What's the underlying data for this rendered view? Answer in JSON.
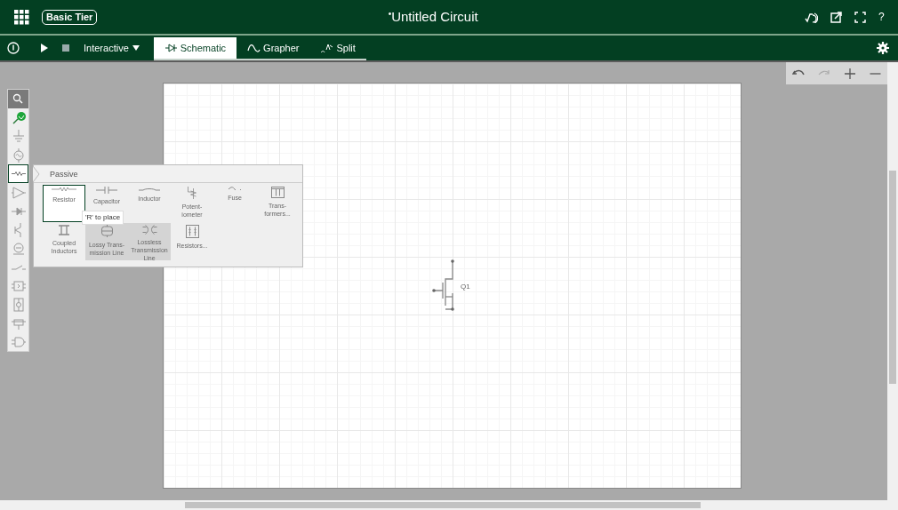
{
  "header": {
    "tier_badge": "Basic Tier",
    "modified_mark": "•",
    "title": "Untitled Circuit",
    "help": "?"
  },
  "toolbar": {
    "mode": "Interactive",
    "views": [
      {
        "label": "Schematic",
        "selected": true
      },
      {
        "label": "Grapher",
        "selected": false
      },
      {
        "label": "Split",
        "selected": false
      }
    ]
  },
  "palette": {
    "items": [
      {
        "selected": false
      },
      {
        "selected": false
      },
      {
        "selected": false
      },
      {
        "selected": false
      },
      {
        "selected": true
      },
      {
        "selected": false
      },
      {
        "selected": false
      },
      {
        "selected": false
      },
      {
        "selected": false
      },
      {
        "selected": false
      },
      {
        "selected": false
      },
      {
        "selected": false
      },
      {
        "selected": false
      },
      {
        "selected": false
      }
    ]
  },
  "popup": {
    "category": "Passive",
    "components": [
      {
        "lines": [
          "Resistor"
        ],
        "selected": true,
        "highlighted": false
      },
      {
        "lines": [
          "Capacitor"
        ],
        "selected": false,
        "highlighted": false
      },
      {
        "lines": [
          "Inductor"
        ],
        "selected": false,
        "highlighted": false
      },
      {
        "lines": [
          "Potent-",
          "iometer"
        ],
        "selected": false,
        "highlighted": false
      },
      {
        "lines": [
          "Fuse"
        ],
        "selected": false,
        "highlighted": false
      },
      {
        "lines": [
          "Trans-",
          "formers..."
        ],
        "selected": false,
        "highlighted": false
      },
      {
        "lines": [
          "Coupled",
          "Inductors"
        ],
        "selected": false,
        "highlighted": false
      },
      {
        "lines": [
          "Lossy Trans-",
          "mission Line"
        ],
        "selected": false,
        "highlighted": true
      },
      {
        "lines": [
          "Lossless",
          "Transmission",
          "Line"
        ],
        "selected": false,
        "highlighted": true
      },
      {
        "lines": [
          "Resistors..."
        ],
        "selected": false,
        "highlighted": false
      }
    ],
    "tooltip": "'R' to place"
  },
  "schematic": {
    "parts": [
      {
        "label": "Q1"
      }
    ]
  }
}
